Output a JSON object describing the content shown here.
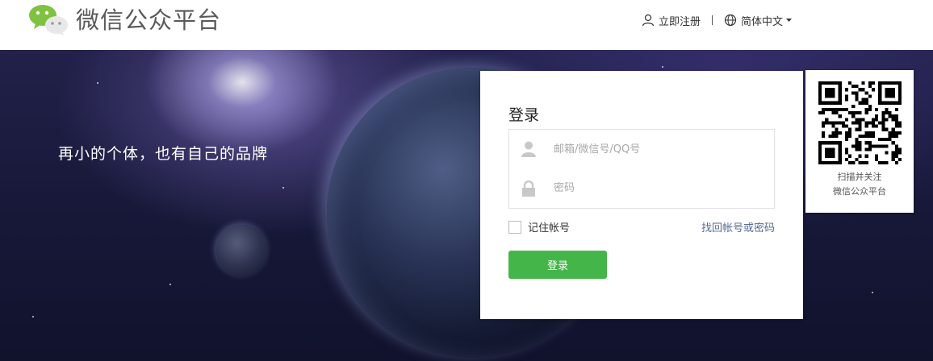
{
  "header": {
    "site_title": "微信公众平台",
    "register_label": "立即注册",
    "language_label": "简体中文",
    "brand_color": "#44b549"
  },
  "banner": {
    "slogan": "再小的个体，也有自己的品牌"
  },
  "login": {
    "title": "登录",
    "account_placeholder": "邮箱/微信号/QQ号",
    "password_placeholder": "密码",
    "remember_label": "记住帐号",
    "forgot_label": "找回帐号或密码",
    "submit_label": "登录",
    "button_color": "#44b549",
    "link_color": "#576b95"
  },
  "qr": {
    "caption_line1": "扫描并关注",
    "caption_line2": "微信公众平台"
  },
  "icons": [
    "wechat-logo-icon",
    "user-icon",
    "globe-icon",
    "chevron-down-icon",
    "person-icon",
    "lock-icon",
    "qr-code-icon"
  ]
}
